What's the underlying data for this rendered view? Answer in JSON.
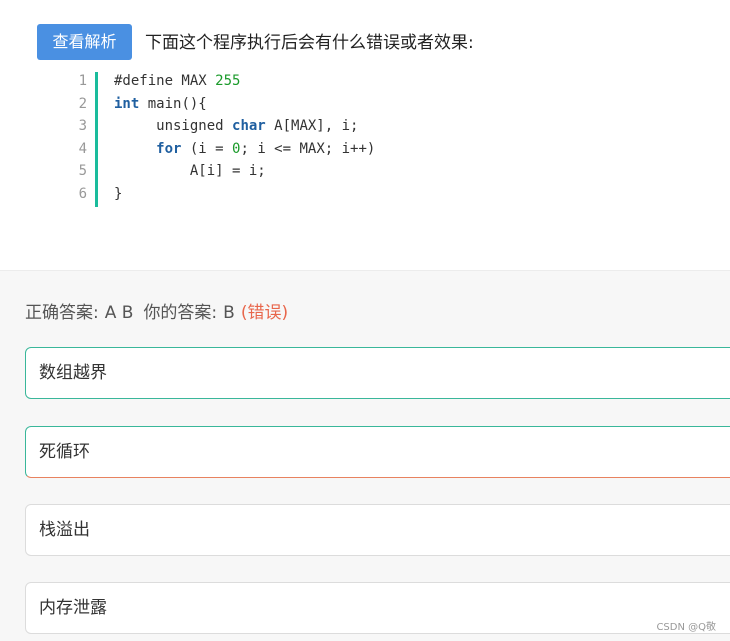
{
  "header": {
    "analysis_button": "查看解析",
    "question": "下面这个程序执行后会有什么错误或者效果:"
  },
  "code": {
    "line_numbers": [
      "1",
      "2",
      "3",
      "4",
      "5",
      "6"
    ],
    "lines": [
      "#define MAX 255",
      "int main(){",
      "     unsigned char A[MAX], i;",
      "     for (i = 0; i <= MAX; i++)",
      "         A[i] = i;",
      "}"
    ]
  },
  "answer": {
    "correct_label": "正确答案:",
    "correct_value": "A B",
    "your_label": "你的答案:",
    "your_value": "B",
    "status": "(错误)"
  },
  "options": [
    {
      "label": "数组越界"
    },
    {
      "label": "死循环"
    },
    {
      "label": "栈溢出"
    },
    {
      "label": "内存泄露"
    }
  ],
  "watermark": "CSDN @Q敬",
  "colors": {
    "button": "#4a90e2",
    "correct_border": "#3ab79a",
    "wrong": "#e8664b",
    "keyword": "#1f5fa0",
    "number": "#1a9a2a"
  }
}
